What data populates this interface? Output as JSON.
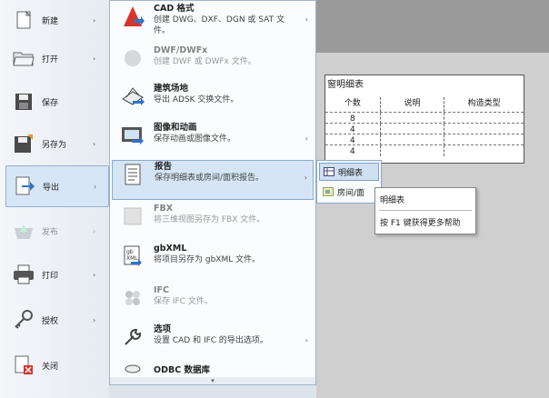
{
  "left_menu": [
    {
      "label": "新建",
      "icon": "new-document-icon",
      "has_arrow": true,
      "state": "normal"
    },
    {
      "label": "打开",
      "icon": "open-folder-icon",
      "has_arrow": true,
      "state": "normal"
    },
    {
      "label": "保存",
      "icon": "save-icon",
      "has_arrow": false,
      "state": "normal"
    },
    {
      "label": "另存为",
      "icon": "save-as-icon",
      "has_arrow": true,
      "state": "normal"
    },
    {
      "label": "导出",
      "icon": "export-icon",
      "has_arrow": true,
      "state": "active"
    },
    {
      "label": "发布",
      "icon": "publish-icon",
      "has_arrow": true,
      "state": "disabled"
    },
    {
      "label": "打印",
      "icon": "print-icon",
      "has_arrow": true,
      "state": "normal"
    },
    {
      "label": "授权",
      "icon": "license-icon",
      "has_arrow": true,
      "state": "normal"
    },
    {
      "label": "关闭",
      "icon": "close-document-icon",
      "has_arrow": false,
      "state": "normal"
    }
  ],
  "export_menu": [
    {
      "title": "CAD 格式",
      "desc": "创建 DWG、DXF、DGN 或 SAT 文件。",
      "icon": "cad-format-icon",
      "has_arrow": true,
      "state": "normal"
    },
    {
      "title": "DWF/DWFx",
      "desc": "创建 DWF 或 DWFx 文件。",
      "icon": "dwf-icon",
      "has_arrow": false,
      "state": "disabled"
    },
    {
      "title": "建筑场地",
      "desc": "导出 ADSK 交换文件。",
      "icon": "building-site-icon",
      "has_arrow": false,
      "state": "normal"
    },
    {
      "title": "图像和动画",
      "desc": "保存动画或图像文件。",
      "icon": "film-icon",
      "has_arrow": true,
      "state": "normal"
    },
    {
      "title": "报告",
      "desc": "保存明细表或房间/面积报告。",
      "icon": "report-icon",
      "has_arrow": true,
      "state": "active"
    },
    {
      "title": "FBX",
      "desc": "将三维视图另存为 FBX 文件。",
      "icon": "fbx-icon",
      "has_arrow": false,
      "state": "disabled"
    },
    {
      "title": "gbXML",
      "desc": "将项目另存为 gbXML 文件。",
      "icon": "gbxml-icon",
      "has_arrow": false,
      "state": "normal"
    },
    {
      "title": "IFC",
      "desc": "保存 IFC 文件。",
      "icon": "ifc-icon",
      "has_arrow": false,
      "state": "disabled"
    },
    {
      "title": "选项",
      "desc": "设置 CAD 和 IFC 的导出选项。",
      "icon": "wrench-icon",
      "has_arrow": true,
      "state": "normal"
    },
    {
      "title": "ODBC 数据库",
      "desc": "",
      "icon": "database-icon",
      "has_arrow": false,
      "state": "normal"
    }
  ],
  "report_submenu": [
    {
      "label": "明细表",
      "icon": "table-icon",
      "state": "active"
    },
    {
      "label": "房间/面",
      "icon": "room-area-icon",
      "state": "normal"
    }
  ],
  "tooltip": {
    "title": "明细表",
    "help": "按 F1 键获得更多帮助"
  },
  "schedule": {
    "title": "窗明细表",
    "headers": [
      "个数",
      "说明",
      "构造类型"
    ],
    "rows": [
      [
        "8",
        "",
        ""
      ],
      [
        "4",
        "",
        ""
      ],
      [
        "4",
        "",
        ""
      ],
      [
        "4",
        "",
        ""
      ]
    ]
  },
  "colors": {
    "accent": "#d6e5f5",
    "accent_border": "#88abd1",
    "export_arrow": "#2f74c9",
    "close_x": "#d9312b"
  }
}
